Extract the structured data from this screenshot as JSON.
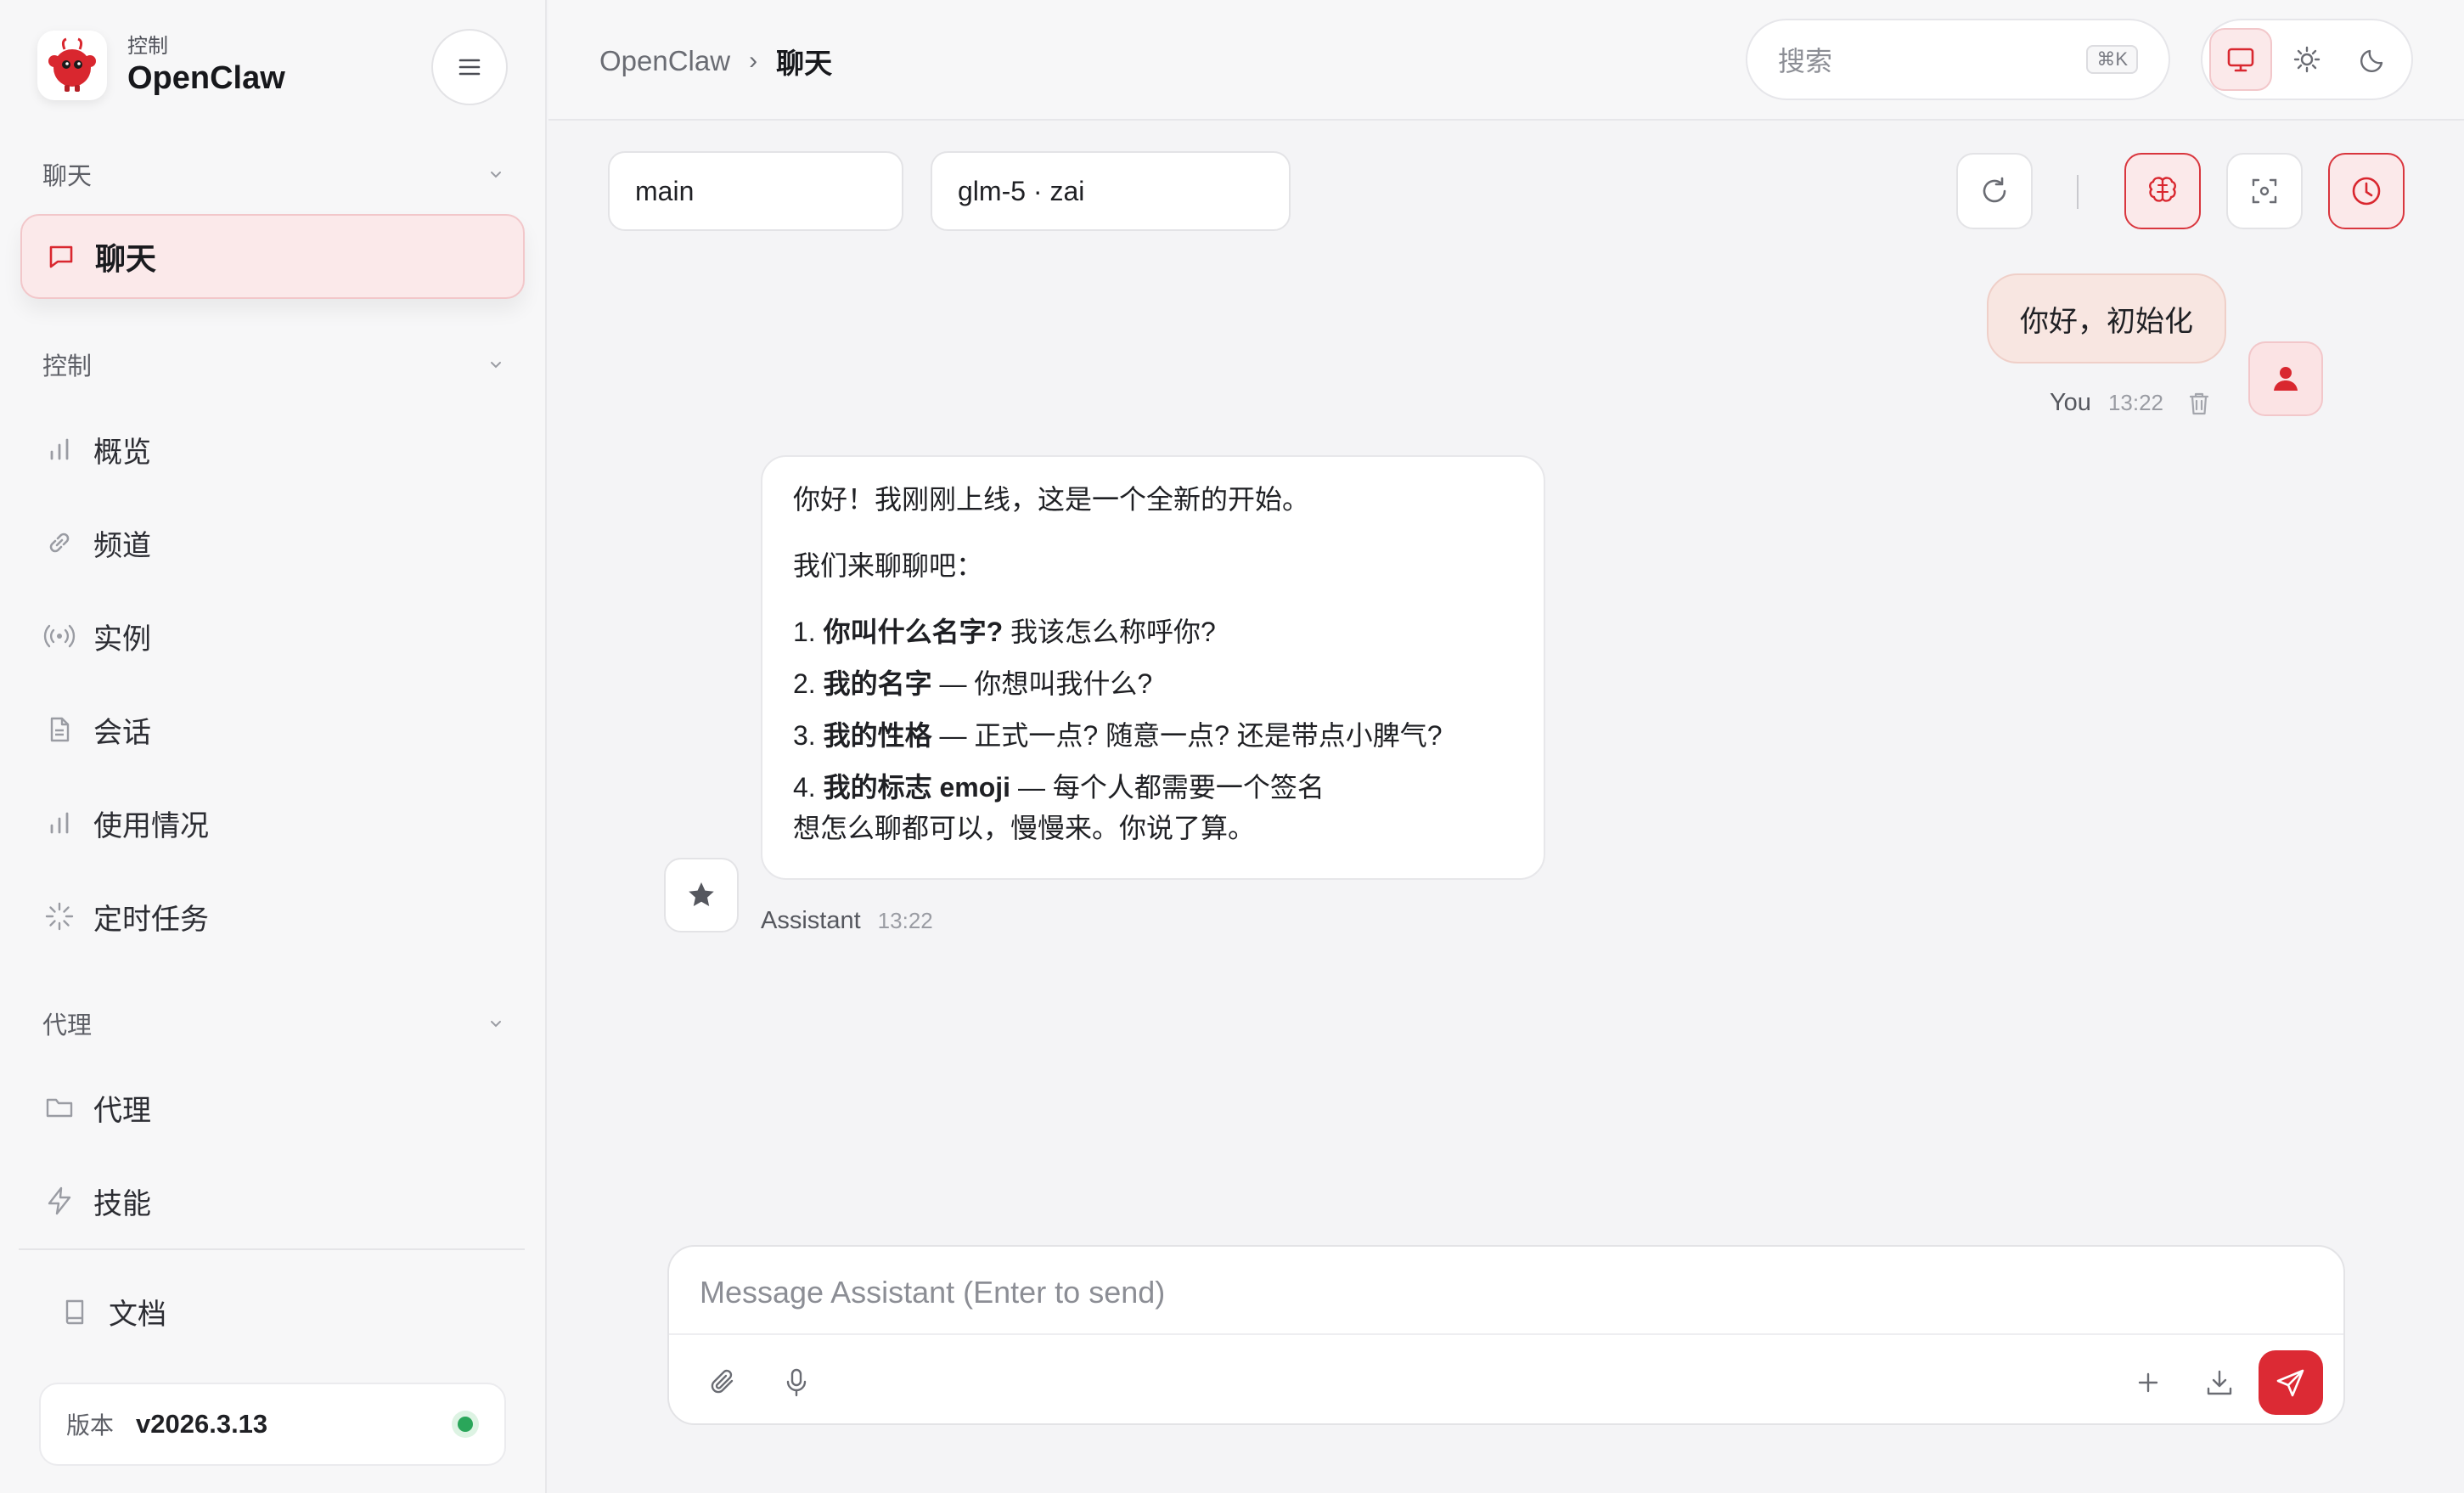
{
  "sidebar": {
    "brand_sub": "控制",
    "brand_name": "OpenClaw",
    "sections": {
      "chat": "聊天",
      "control": "控制",
      "agent": "代理"
    },
    "active_item": "聊天",
    "control_items": [
      "概览",
      "频道",
      "实例",
      "会话",
      "使用情况",
      "定时任务"
    ],
    "agent_items": [
      "代理",
      "技能"
    ],
    "docs": "文档",
    "version_label": "版本",
    "version_value": "v2026.3.13"
  },
  "topbar": {
    "breadcrumb_root": "OpenClaw",
    "breadcrumb_sep": "›",
    "breadcrumb_current": "聊天",
    "search_placeholder": "搜索",
    "search_shortcut": "⌘K"
  },
  "chat": {
    "session_select": "main",
    "model_select": "glm-5 · zai",
    "separator": "|",
    "user_message": "你好，初始化",
    "user_name": "You",
    "user_time": "13:22",
    "assistant_intro": "你好！我刚刚上线，这是一个全新的开始。",
    "assistant_lead": "我们来聊聊吧：",
    "assistant_list": [
      {
        "num": "1.",
        "bold": "你叫什么名字?",
        "rest": " 我该怎么称呼你?"
      },
      {
        "num": "2.",
        "bold": "我的名字",
        "rest": " — 你想叫我什么?"
      },
      {
        "num": "3.",
        "bold": "我的性格",
        "rest": " — 正式一点? 随意一点? 还是带点小脾气?"
      },
      {
        "num": "4.",
        "bold": "我的标志 emoji",
        "rest": " — 每个人都需要一个签名"
      }
    ],
    "assistant_outro": "想怎么聊都可以，慢慢来。你说了算。",
    "assistant_name": "Assistant",
    "assistant_time": "13:22",
    "composer_placeholder": "Message Assistant (Enter to send)"
  },
  "colors": {
    "accent": "#dc2a34",
    "accent_soft": "#fbe9ea",
    "status_online": "#2aa65a"
  },
  "icons": [
    "menu-icon",
    "chat-bubble-icon",
    "bar-chart-icon",
    "link-icon",
    "broadcast-icon",
    "document-icon",
    "loader-icon",
    "folder-icon",
    "lightning-icon",
    "book-icon",
    "monitor-icon",
    "sun-icon",
    "moon-icon",
    "refresh-icon",
    "brain-icon",
    "focus-icon",
    "clock-icon",
    "trash-icon",
    "user-icon",
    "star-icon",
    "paperclip-icon",
    "microphone-icon",
    "plus-icon",
    "download-icon",
    "send-icon"
  ]
}
